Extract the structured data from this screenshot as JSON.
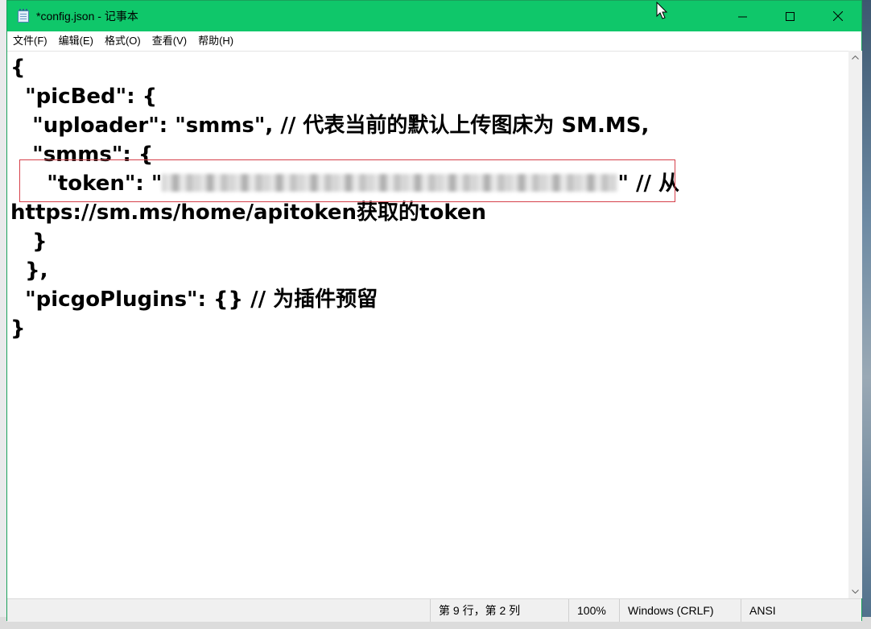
{
  "window": {
    "title": "*config.json - 记事本"
  },
  "menu": {
    "items": [
      "文件(F)",
      "编辑(E)",
      "格式(O)",
      "查看(V)",
      "帮助(H)"
    ]
  },
  "editor": {
    "lines": [
      "{",
      "  \"picBed\": {",
      "   \"uploader\": \"smms\", // 代表当前的默认上传图床为 SM.MS,",
      "   \"smms\": {",
      "",
      "https://sm.ms/home/apitoken获取的token",
      "   }",
      "  },",
      "  \"picgoPlugins\": {} // 为插件预留",
      "}"
    ],
    "token_line": {
      "prefix": "     \"token\": \"",
      "suffix": "\" // 从"
    }
  },
  "status": {
    "position": "第 9 行，第 2 列",
    "zoom": "100%",
    "line_ending": "Windows (CRLF)",
    "encoding": "ANSI"
  },
  "colors": {
    "titlebar": "#0fc76a",
    "highlight_border": "#d6404a"
  }
}
